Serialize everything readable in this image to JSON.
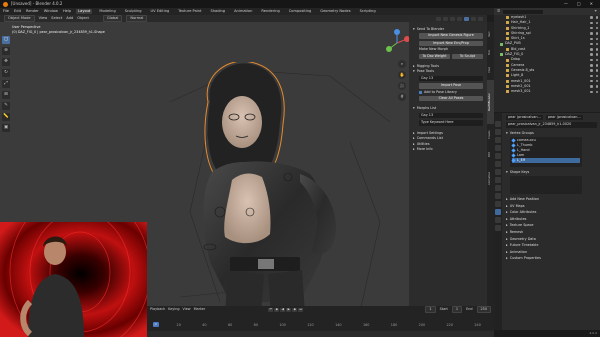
{
  "app": {
    "title": "[Unsaved] - Blender 4.0.2",
    "version": "4.0.2"
  },
  "menu": {
    "items": [
      "File",
      "Edit",
      "Render",
      "Window",
      "Help"
    ],
    "workspaces": [
      "Layout",
      "Modeling",
      "Sculpting",
      "UV Editing",
      "Texture Paint",
      "Shading",
      "Animation",
      "Rendering",
      "Compositing",
      "Geometry Nodes",
      "Scripting"
    ],
    "active_workspace": "Layout",
    "scene": "Scene",
    "view_layer": "ViewLayer"
  },
  "viewport_header": {
    "mode": "Object Mode",
    "menus": [
      "View",
      "Select",
      "Add",
      "Object"
    ],
    "orientation": "Global",
    "pivot": "Normal"
  },
  "viewport": {
    "view_label": "User Perspective",
    "collection_line": "(0) DAZ_FIG_0 | pear_prosicalvan_jr_234859_h1-Shape",
    "accent_outline": "#e68a2e",
    "background": "#3b3b3b"
  },
  "npanel": {
    "send_to_blender": "Send To Blender",
    "import_new_figure": "Import New Genesis Figure",
    "import_new_env": "Import New Env/Prop",
    "make_new_morph": "Make New Morph",
    "to_daz": "To Daz Weight",
    "to_sculpt": "To Sculpt",
    "rigging_tools": "Rigging Tools",
    "pose_tools": "Pose Tools",
    "pose_field": "Gay 13",
    "import_pose": "Import Pose",
    "add_to_pose_library": "Add to Pose Library",
    "clear_all_poses": "Clear All Poses",
    "morphs_list": "Morphs List",
    "morph_field": "Gay 13",
    "type_keyword": "Type Keyword Here",
    "import_settings": "Import Settings",
    "commands_list": "Commands List",
    "utilities": "Utilities",
    "more_info": "More Info"
  },
  "vtabs": [
    "Item",
    "Tool",
    "View",
    "DazToBlender",
    "Create",
    "Edit",
    "Animation"
  ],
  "outliner": {
    "items": [
      {
        "name": "eyelash1",
        "color": "#d4a94a"
      },
      {
        "name": "Hair_Hair_1",
        "color": "#d4a94a"
      },
      {
        "name": "Shirtring_1",
        "color": "#d4a94a"
      },
      {
        "name": "Shirring_spl",
        "color": "#d4a94a"
      },
      {
        "name": "Shirt_1s",
        "color": "#d4a94a"
      },
      {
        "name": "DAZ_PUB",
        "color": "#7cc06b"
      },
      {
        "name": "Bld_cast",
        "color": "#d4a94a"
      },
      {
        "name": "DAZ_FIG_0",
        "color": "#7cc06b"
      },
      {
        "name": "Ddap",
        "color": "#d4a94a"
      },
      {
        "name": "Camera",
        "color": "#d4a94a"
      },
      {
        "name": "Genesis 8_sts",
        "color": "#d4a94a"
      },
      {
        "name": "Light_8",
        "color": "#d4a94a"
      },
      {
        "name": "mesh1_001",
        "color": "#d4a94a"
      },
      {
        "name": "mesh2_001",
        "color": "#d4a94a"
      },
      {
        "name": "mesh3_001",
        "color": "#d4a94a"
      }
    ]
  },
  "properties": {
    "object_a": "pear (prosicalvan…",
    "object_b": "pear (prosicalvan…",
    "name": "pear_prosicalvan_jr_234859_h1-0020",
    "vertex_groups": "Vertex Groups",
    "groups": [
      "cornea.ocu",
      "L_Thumb",
      "L_Hand",
      "Lam",
      "L_Elf"
    ],
    "shape_keys": "Shape Keys",
    "sections": [
      "Add New Position",
      "UV Maps",
      "Color Attributes",
      "Attributes",
      "Texture Space",
      "Remesh",
      "Geometry Data",
      "Future Timetable",
      "Animation",
      "Custom Properties"
    ]
  },
  "timeline": {
    "menus": [
      "Playback",
      "Keying",
      "View",
      "Marker"
    ],
    "current_frame": "1",
    "start_label": "Start",
    "start": "1",
    "end_label": "End",
    "end": "250",
    "frames": [
      "0",
      "20",
      "40",
      "60",
      "80",
      "100",
      "120",
      "140",
      "160",
      "180",
      "200",
      "220",
      "240"
    ],
    "last_frame_hint": "1  Current Frame"
  },
  "status": {
    "version": "4.0.2"
  }
}
